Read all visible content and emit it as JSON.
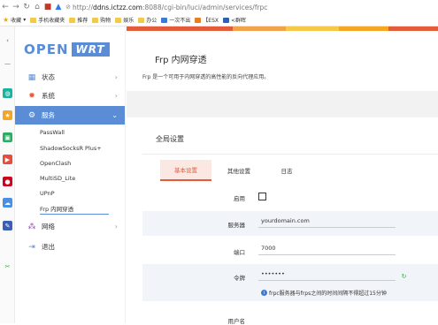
{
  "browser": {
    "url_prefix": "http://",
    "url_host": "ddns.ictzz.com",
    "url_path": ":8088/cgi-bin/luci/admin/services/frpc",
    "bookmarks": [
      {
        "label": "收藏",
        "icon": "star-icon"
      },
      {
        "label": "手机收藏夹",
        "icon": "folder-icon"
      },
      {
        "label": "推荐",
        "icon": "folder-icon"
      },
      {
        "label": "购物",
        "icon": "folder-icon"
      },
      {
        "label": "娱乐",
        "icon": "folder-icon"
      },
      {
        "label": "办公",
        "icon": "folder-icon"
      },
      {
        "label": "一次不出",
        "icon": "site-icon"
      },
      {
        "label": "【ESX",
        "icon": "site-icon"
      },
      {
        "label": "<群晖",
        "icon": "site-icon"
      }
    ]
  },
  "logo": {
    "part1": "OPEN",
    "part2": "WRT"
  },
  "menu": {
    "items": [
      {
        "label": "状态",
        "icon": "status-grid-icon"
      },
      {
        "label": "系统",
        "icon": "system-gear-icon"
      },
      {
        "label": "服务",
        "icon": "services-gear-icon"
      },
      {
        "label": "网络",
        "icon": "network-icon"
      },
      {
        "label": "退出",
        "icon": "logout-icon"
      }
    ],
    "services_sub": [
      "PassWall",
      "ShadowSocksR Plus+",
      "OpenClash",
      "MultiSD_Lite",
      "UPnP",
      "Frp 内网穿透"
    ]
  },
  "page": {
    "title": "Frp 内网穿透",
    "description": "Frp 是一个可用于内网穿透的高性能的反向代理应用。",
    "section_title": "全局设置",
    "tabs": [
      "基本设置",
      "其他设置",
      "日志"
    ]
  },
  "form": {
    "enable_label": "启用",
    "server_label": "服务器",
    "server_value": "yourdomain.com",
    "port_label": "端口",
    "port_value": "7000",
    "token_label": "令牌",
    "token_value": "•••••••",
    "token_hint": "frpc服务器与frps之间的时间间隔不得超过15分钟",
    "user_label": "用户名"
  },
  "colors": {
    "accent": "#5b8dd6",
    "tab_active": "#e25c3b"
  }
}
